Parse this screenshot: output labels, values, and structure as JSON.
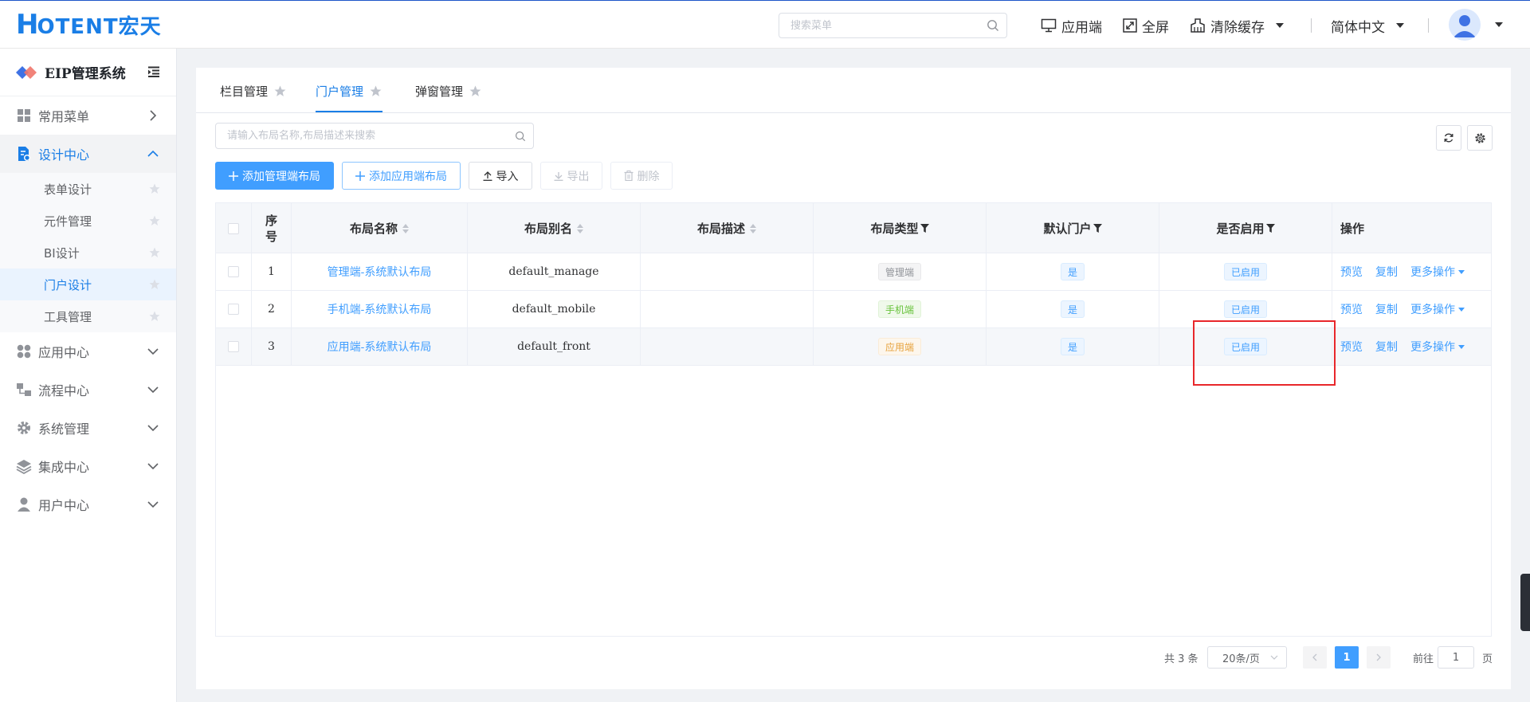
{
  "header": {
    "logo_h": "H",
    "logo_text": "OTENT宏天",
    "search_placeholder": "搜索菜单",
    "app_label": "应用端",
    "fullscreen_label": "全屏",
    "clear_cache_label": "清除缓存",
    "language_label": "简体中文"
  },
  "sidebar": {
    "title": "EIP管理系统",
    "groups": [
      {
        "label": "常用菜单"
      },
      {
        "label": "设计中心"
      },
      {
        "label": "应用中心"
      },
      {
        "label": "流程中心"
      },
      {
        "label": "系统管理"
      },
      {
        "label": "集成中心"
      },
      {
        "label": "用户中心"
      }
    ],
    "design_children": [
      {
        "label": "表单设计"
      },
      {
        "label": "元件管理"
      },
      {
        "label": "BI设计"
      },
      {
        "label": "门户设计"
      },
      {
        "label": "工具管理"
      }
    ]
  },
  "tabs": [
    {
      "label": "栏目管理"
    },
    {
      "label": "门户管理"
    },
    {
      "label": "弹窗管理"
    }
  ],
  "toolbar": {
    "search_placeholder": "请输入布局名称,布局描述来搜索",
    "add_manage_label": "添加管理端布局",
    "add_front_label": "添加应用端布局",
    "import_label": "导入",
    "export_label": "导出",
    "delete_label": "删除"
  },
  "table": {
    "columns": {
      "index": "序号",
      "name": "布局名称",
      "alias": "布局别名",
      "desc": "布局描述",
      "type": "布局类型",
      "default": "默认门户",
      "enabled": "是否启用",
      "ops": "操作"
    },
    "rows": [
      {
        "index": "1",
        "name": "管理端-系统默认布局",
        "alias": "default_manage",
        "desc": "",
        "type": "管理端",
        "default": "是",
        "enabled": "已启用"
      },
      {
        "index": "2",
        "name": "手机端-系统默认布局",
        "alias": "default_mobile",
        "desc": "",
        "type": "手机端",
        "default": "是",
        "enabled": "已启用"
      },
      {
        "index": "3",
        "name": "应用端-系统默认布局",
        "alias": "default_front",
        "desc": "",
        "type": "应用端",
        "default": "是",
        "enabled": "已启用"
      }
    ],
    "op_preview": "预览",
    "op_copy": "复制",
    "op_more": "更多操作"
  },
  "pagination": {
    "total": "共 3 条",
    "page_size": "20条/页",
    "current_page": "1",
    "goto_prefix": "前往",
    "goto_value": "1",
    "goto_suffix": "页"
  },
  "colors": {
    "primary": "#409eff",
    "brand": "#1a7ee6",
    "highlight": "#e8272b"
  }
}
